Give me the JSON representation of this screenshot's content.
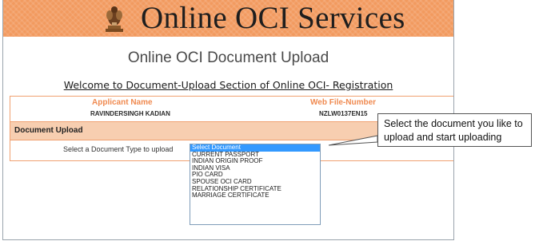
{
  "banner": {
    "title": "Online OCI Services",
    "emblem_icon": "national-emblem-icon"
  },
  "page": {
    "heading": "Online OCI Document Upload",
    "welcome": "Welcome to Document-Upload Section of Online OCI- Registration"
  },
  "applicant": {
    "name_label": "Applicant Name",
    "name_value": "RAVINDERSINGH KADIAN",
    "file_label": "Web File-Number",
    "file_value": "NZLW0137EN15"
  },
  "document_upload": {
    "section_title": "Document Upload",
    "select_label": "Select a Document Type to upload",
    "selected": "Select Document",
    "options": [
      "Select Document",
      "CURRENT PASSPORT",
      "INDIAN ORIGIN PROOF",
      "INDIAN VISA",
      "PIO CARD",
      "SPOUSE OCI CARD",
      "RELATIONSHIP CERTIFICATE",
      "MARRIAGE CERTIFICATE"
    ]
  },
  "callout": {
    "line1": "Select the document you like to",
    "line2": "upload and start uploading"
  },
  "colors": {
    "banner": "#f29a5f",
    "accent_orange": "#f08a50",
    "section_header": "#f7ceb0",
    "selected_option": "#3399ff"
  }
}
